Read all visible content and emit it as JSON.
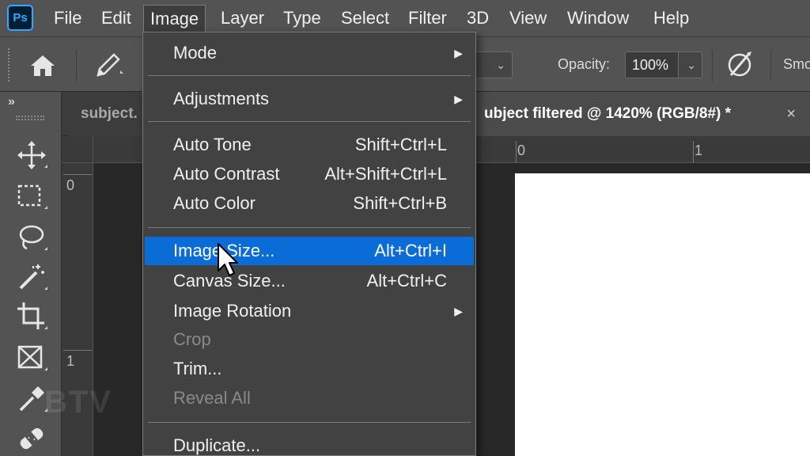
{
  "menubar": {
    "logo": "Ps",
    "items": [
      {
        "label": "File"
      },
      {
        "label": "Edit"
      },
      {
        "label": "Image"
      },
      {
        "label": "Layer"
      },
      {
        "label": "Type"
      },
      {
        "label": "Select"
      },
      {
        "label": "Filter"
      },
      {
        "label": "3D"
      },
      {
        "label": "View"
      },
      {
        "label": "Window"
      },
      {
        "label": "Help"
      }
    ],
    "active": "Image"
  },
  "options": {
    "opacity_label": "Opacity:",
    "opacity_value": "100%",
    "smoothing_label": "Smo"
  },
  "tabs": {
    "inactive_label": "subject.",
    "active_label": "ubject filtered @ 1420% (RGB/8#) *",
    "close_icon": "×"
  },
  "rulers": {
    "top": [
      "0",
      "1"
    ],
    "left": [
      "0",
      "1"
    ]
  },
  "tools": [
    "move-icon",
    "marquee-icon",
    "lasso-icon",
    "magic-wand-icon",
    "crop-icon",
    "frame-icon",
    "eyedropper-icon",
    "healing-icon"
  ],
  "dropdown": {
    "items": [
      {
        "label": "Mode",
        "shortcut": "",
        "submenu": true
      },
      {
        "label": "Adjustments",
        "shortcut": "",
        "submenu": true
      },
      {
        "label": "Auto Tone",
        "shortcut": "Shift+Ctrl+L"
      },
      {
        "label": "Auto Contrast",
        "shortcut": "Alt+Shift+Ctrl+L"
      },
      {
        "label": "Auto Color",
        "shortcut": "Shift+Ctrl+B"
      },
      {
        "label": "Image Size...",
        "shortcut": "Alt+Ctrl+I",
        "highlighted": true
      },
      {
        "label": "Canvas Size...",
        "shortcut": "Alt+Ctrl+C"
      },
      {
        "label": "Image Rotation",
        "shortcut": "",
        "submenu": true
      },
      {
        "label": "Crop",
        "shortcut": "",
        "disabled": true
      },
      {
        "label": "Trim...",
        "shortcut": ""
      },
      {
        "label": "Reveal All",
        "shortcut": "",
        "disabled": true
      },
      {
        "label": "Duplicate...",
        "shortcut": ""
      }
    ]
  },
  "colors": {
    "menu_highlight": "#0a6cd6",
    "ps_blue": "#31a8ff",
    "panel_bg": "#535353"
  }
}
